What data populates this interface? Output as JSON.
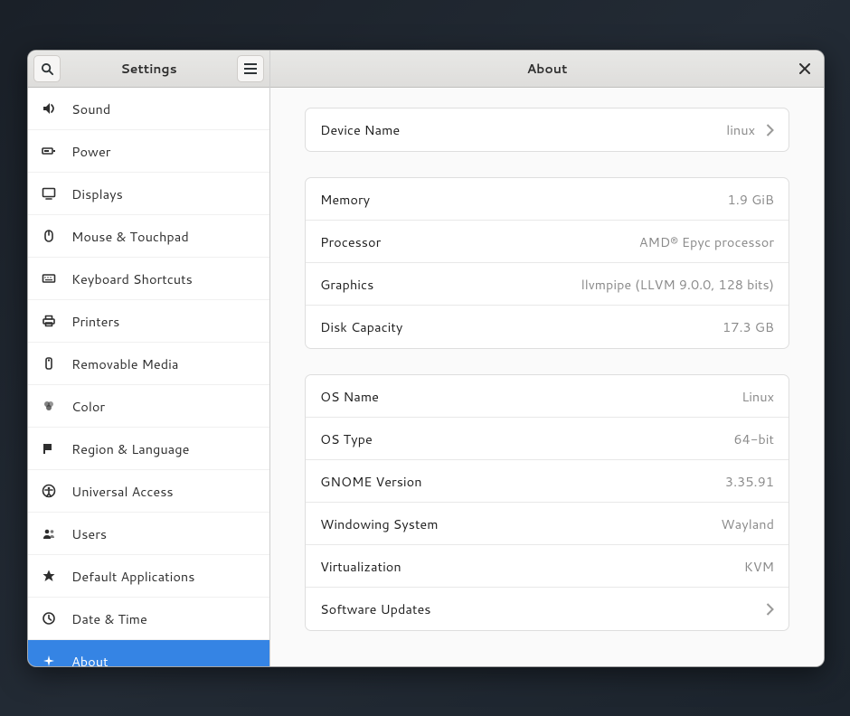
{
  "sidebar": {
    "title": "Settings",
    "items": [
      {
        "id": "sound",
        "label": "Sound"
      },
      {
        "id": "power",
        "label": "Power"
      },
      {
        "id": "displays",
        "label": "Displays"
      },
      {
        "id": "mouse-touchpad",
        "label": "Mouse & Touchpad"
      },
      {
        "id": "keyboard-shortcuts",
        "label": "Keyboard Shortcuts"
      },
      {
        "id": "printers",
        "label": "Printers"
      },
      {
        "id": "removable-media",
        "label": "Removable Media"
      },
      {
        "id": "color",
        "label": "Color"
      },
      {
        "id": "region-language",
        "label": "Region & Language"
      },
      {
        "id": "universal-access",
        "label": "Universal Access"
      },
      {
        "id": "users",
        "label": "Users"
      },
      {
        "id": "default-apps",
        "label": "Default Applications"
      },
      {
        "id": "date-time",
        "label": "Date & Time"
      },
      {
        "id": "about",
        "label": "About"
      }
    ],
    "selected": "about"
  },
  "main": {
    "title": "About",
    "device": {
      "device_name_label": "Device Name",
      "device_name_value": "linux"
    },
    "hardware": {
      "memory_label": "Memory",
      "memory_value": "1.9 GiB",
      "processor_label": "Processor",
      "processor_value": "AMD® Epyc processor",
      "graphics_label": "Graphics",
      "graphics_value": "llvmpipe (LLVM 9.0.0, 128 bits)",
      "disk_label": "Disk Capacity",
      "disk_value": "17.3 GB"
    },
    "os": {
      "osname_label": "OS Name",
      "osname_value": "Linux",
      "ostype_label": "OS Type",
      "ostype_value": "64-bit",
      "gnome_label": "GNOME Version",
      "gnome_value": "3.35.91",
      "windowing_label": "Windowing System",
      "windowing_value": "Wayland",
      "virt_label": "Virtualization",
      "virt_value": "KVM",
      "updates_label": "Software Updates"
    }
  }
}
